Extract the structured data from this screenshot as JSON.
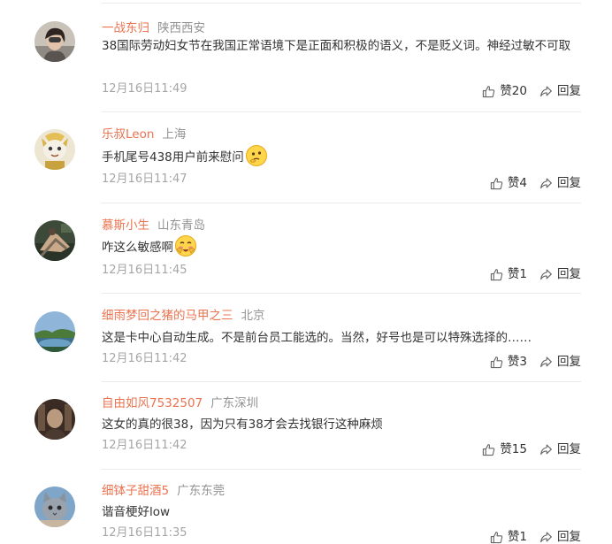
{
  "comments": [
    {
      "username": "一战东归",
      "location": "陕西西安",
      "text": "38国际劳动妇女节在我国正常语境下是正面和积极的语义，不是贬义词。神经过敏不可取",
      "emoji": "",
      "time": "12月16日11:49",
      "like_label": "赞20",
      "reply_label": "回复"
    },
    {
      "username": "乐叔Leon",
      "location": "上海",
      "text": "手机尾号438用户前来慰问",
      "emoji": "thinking-face",
      "time": "12月16日11:47",
      "like_label": "赞4",
      "reply_label": "回复"
    },
    {
      "username": "慕斯小生",
      "location": "山东青岛",
      "text": "咋这么敏感啊",
      "emoji": "blushing-face",
      "time": "12月16日11:45",
      "like_label": "赞1",
      "reply_label": "回复"
    },
    {
      "username": "细雨梦回之猪的马甲之三",
      "location": "北京",
      "text": "这是卡中心自动生成。不是前台员工能选的。当然，好号也是可以特殊选择的……",
      "emoji": "",
      "time": "12月16日11:42",
      "like_label": "赞3",
      "reply_label": "回复"
    },
    {
      "username": "自由如风7532507",
      "location": "广东深圳",
      "text": "这女的真的很38，因为只有38才会去找银行这种麻烦",
      "emoji": "",
      "time": "12月16日11:42",
      "like_label": "赞15",
      "reply_label": "回复"
    },
    {
      "username": "细钵子甜酒5",
      "location": "广东东莞",
      "text": "谐音梗好low",
      "emoji": "",
      "time": "12月16日11:35",
      "like_label": "赞1",
      "reply_label": "回复"
    }
  ],
  "icons": {
    "like": "thumbs-up-icon",
    "reply": "reply-arrow-icon"
  },
  "colors": {
    "username": "#eb7350",
    "location": "#939393",
    "timestamp": "#a6a6a6",
    "text": "#333333",
    "divider": "#eaeaea"
  }
}
